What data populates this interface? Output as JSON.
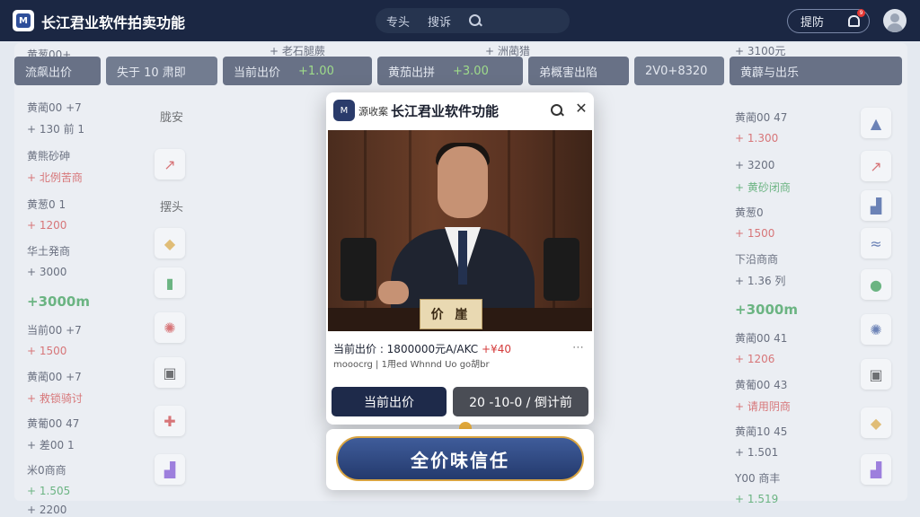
{
  "header": {
    "app_title": "长江君业软件拍卖功能",
    "nav_items": [
      "专头",
      "搜诉"
    ],
    "action_label": "提防",
    "notification_count": "9"
  },
  "strip": [
    {
      "label": "流飙出价"
    },
    {
      "label": "失于 10 肃即"
    },
    {
      "label": "当前出价",
      "value": "+1.00"
    },
    {
      "label": "黄茄出拼",
      "value": "+3.00"
    },
    {
      "label": "弟概害出陷"
    },
    {
      "label": "2V0+8320"
    },
    {
      "label": "黄薜与出乐"
    }
  ],
  "left_column": [
    {
      "label": "黄蔺00 +7",
      "value": "+ 130 前 1"
    },
    {
      "label": "黄熊砂砷",
      "value": "+ 北例苦商"
    },
    {
      "label": "黄葱0 1",
      "value": "+ 1200"
    },
    {
      "label": "华土発商",
      "value": "+ 3000"
    },
    {
      "big": "+3000m"
    },
    {
      "label": "当前00 +7",
      "value": "+ 1500"
    },
    {
      "label": "黄蔺00 +7",
      "value": "+ 救锁骑讨"
    },
    {
      "label": "黄葡00 47",
      "value": "+ 差00 1"
    },
    {
      "label": "米0商商",
      "value": "+ 1.505"
    }
  ],
  "left_side_labels": [
    "胧安",
    "摆头"
  ],
  "right_column": [
    {
      "label": "黄蔺00 47",
      "value": "+ 1.300"
    },
    {
      "label": "+ 3200",
      "value": "+ 黄砂闭商"
    },
    {
      "label": "黄葱0",
      "value": "+ 1500"
    },
    {
      "label": "下沿商商",
      "value": "+ 1.36 列"
    },
    {
      "big": "+3000m"
    },
    {
      "label": "黄蔺00 41",
      "value": "+ 1206"
    },
    {
      "label": "黄葡00 43",
      "value": "+ 请用阴商"
    },
    {
      "label": "黄蔺10 45",
      "value": "+ 1.501"
    },
    {
      "label": "Y00 商丰",
      "value": "+ 1.519"
    }
  ],
  "peek_top": {
    "left": "黄葱00+",
    "mid1": "+ 老石腿蕨",
    "mid2": "+ 洲蔺猎",
    "right": "+ 3100元"
  },
  "peek_bottom": {
    "left": "+ 2200"
  },
  "modal": {
    "source_label": "源收案",
    "title": "长江君业软件功能",
    "nameplate": "价 崖",
    "bid_line": "当前出价 : 1800000元A/AKC",
    "bid_delta": "+¥40",
    "sub_line": "mooocrg | 1用ed Whnnd Uo go胡br",
    "btn_current": "当前出价",
    "btn_timer": "20 -10-0 / 倒计前"
  },
  "trust_button": "全价味信任",
  "colors": {
    "topbar": "#1b2743",
    "accent_navy": "#1e2a4a",
    "up_green": "#2e9b4a",
    "down_red": "#d43b3b",
    "gold_border": "#d9a441"
  }
}
